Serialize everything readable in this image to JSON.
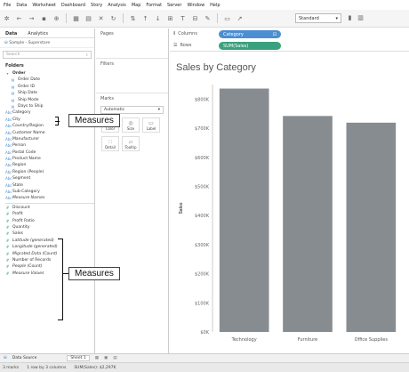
{
  "menu": [
    "File",
    "Data",
    "Worksheet",
    "Dashboard",
    "Story",
    "Analysis",
    "Map",
    "Format",
    "Server",
    "Window",
    "Help"
  ],
  "toolbar": {
    "fit_select": "Standard"
  },
  "data_pane": {
    "tabs": [
      "Data",
      "Analytics"
    ],
    "datasource": "Sample - Superstore",
    "search_placeholder": "Search",
    "folders_label": "Folders",
    "order_group": "Order",
    "order_fields": [
      "Order Date",
      "Order ID",
      "Ship Date",
      "Ship Mode",
      "Days to Ship"
    ],
    "dimensions": [
      "Category",
      "City",
      "Country/Region",
      "Customer Name",
      "Manufacturer",
      "Person",
      "Postal Code",
      "Product Name",
      "Region",
      "Region (People)",
      "Segment",
      "State",
      "Sub-Category",
      "Measure Names"
    ],
    "measures": [
      "Discount",
      "Profit",
      "Profit Ratio",
      "Quantity",
      "Sales",
      "Latitude (generated)",
      "Longitude (generated)",
      "Migrated Data (Count)",
      "Number of Records",
      "People (Count)",
      "Measure Values"
    ]
  },
  "cards": {
    "pages": "Pages",
    "filters": "Filters",
    "marks": "Marks",
    "marks_type": "Automatic",
    "buttons": [
      "Color",
      "Size",
      "Label",
      "Detail",
      "Tooltip"
    ]
  },
  "shelves": {
    "columns_label": "Columns",
    "rows_label": "Rows",
    "columns_pill": "Category",
    "rows_pill": "SUM(Sales)"
  },
  "colors": {
    "dimension_pill": "#4b8fd2",
    "measure_pill": "#3aa17e",
    "bar": "#878c91"
  },
  "chart_data": {
    "type": "bar",
    "title": "Sales by Category",
    "ylabel": "Sales",
    "categories": [
      "Technology",
      "Furniture",
      "Office Supplies"
    ],
    "values": [
      836154,
      741999,
      719047
    ],
    "ylim": [
      0,
      850000
    ],
    "yticks": [
      "$0K",
      "$100K",
      "$200K",
      "$300K",
      "$400K",
      "$500K",
      "$600K",
      "$700K",
      "$800K"
    ],
    "grid": false
  },
  "bottom": {
    "datasource_tab": "Data Source",
    "sheet_tab": "Sheet 1",
    "status": [
      "3 marks",
      "1 row by 3 columns",
      "SUM(Sales): $2,297K"
    ]
  },
  "callouts": {
    "upper": "Measures",
    "lower": "Measures"
  }
}
